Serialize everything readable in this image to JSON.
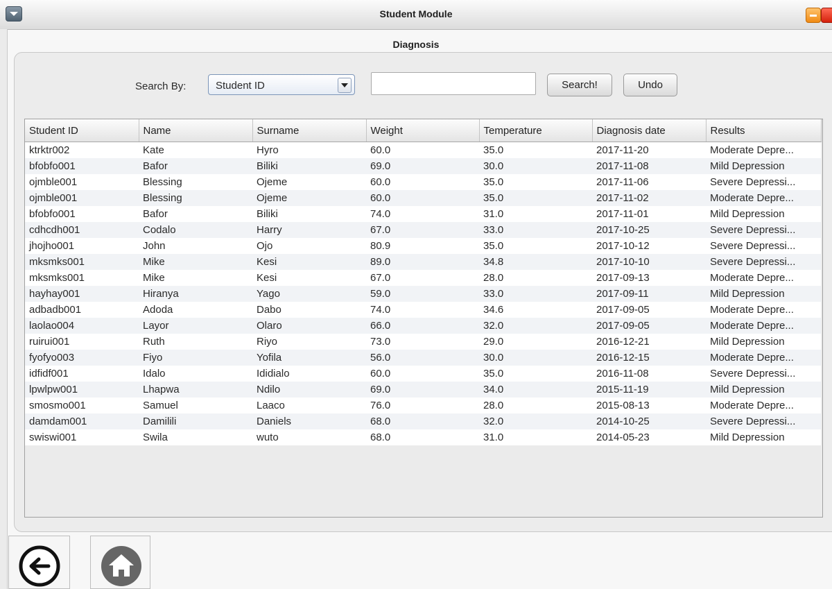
{
  "window": {
    "title": "Student Module"
  },
  "section": {
    "title": "Diagnosis"
  },
  "search": {
    "label": "Search By:",
    "combo_value": "Student ID",
    "field_value": "",
    "search_button": "Search!",
    "undo_button": "Undo"
  },
  "table": {
    "columns": [
      "Student ID",
      "Name",
      "Surname",
      "Weight",
      "Temperature",
      "Diagnosis date",
      "Results"
    ],
    "rows": [
      [
        "ktrktr002",
        "Kate",
        "Hyro",
        "60.0",
        "35.0",
        "2017-11-20",
        "Moderate Depre..."
      ],
      [
        "bfobfo001",
        "Bafor",
        "Biliki",
        "69.0",
        "30.0",
        "2017-11-08",
        "Mild Depression"
      ],
      [
        "ojmble001",
        "Blessing",
        "Ojeme",
        "60.0",
        "35.0",
        "2017-11-06",
        "Severe Depressi..."
      ],
      [
        "ojmble001",
        "Blessing",
        "Ojeme",
        "60.0",
        "35.0",
        "2017-11-02",
        "Moderate Depre..."
      ],
      [
        "bfobfo001",
        "Bafor",
        "Biliki",
        "74.0",
        "31.0",
        "2017-11-01",
        "Mild Depression"
      ],
      [
        "cdhcdh001",
        "Codalo",
        "Harry",
        "67.0",
        "33.0",
        "2017-10-25",
        "Severe Depressi..."
      ],
      [
        "jhojho001",
        "John",
        "Ojo",
        "80.9",
        "35.0",
        "2017-10-12",
        "Severe Depressi..."
      ],
      [
        "mksmks001",
        "Mike",
        "Kesi",
        "89.0",
        "34.8",
        "2017-10-10",
        "Severe Depressi..."
      ],
      [
        "mksmks001",
        "Mike",
        "Kesi",
        "67.0",
        "28.0",
        "2017-09-13",
        "Moderate Depre..."
      ],
      [
        "hayhay001",
        "Hiranya",
        "Yago",
        "59.0",
        "33.0",
        "2017-09-11",
        "Mild Depression"
      ],
      [
        "adbadb001",
        "Adoda",
        "Dabo",
        "74.0",
        "34.6",
        "2017-09-05",
        "Moderate Depre..."
      ],
      [
        "laolao004",
        "Layor",
        "Olaro",
        "66.0",
        "32.0",
        "2017-09-05",
        "Moderate Depre..."
      ],
      [
        "ruirui001",
        "Ruth",
        "Riyo",
        "73.0",
        "29.0",
        "2016-12-21",
        "Mild Depression"
      ],
      [
        "fyofyo003",
        "Fiyo",
        "Yofila",
        "56.0",
        "30.0",
        "2016-12-15",
        "Moderate Depre..."
      ],
      [
        "idfidf001",
        "Idalo",
        "Ididialo",
        "60.0",
        "35.0",
        "2016-11-08",
        "Severe Depressi..."
      ],
      [
        "lpwlpw001",
        "Lhapwa",
        "Ndilo",
        "69.0",
        "34.0",
        "2015-11-19",
        "Mild Depression"
      ],
      [
        "smosmo001",
        "Samuel",
        "Laaco",
        "76.0",
        "28.0",
        "2015-08-13",
        "Moderate Depre..."
      ],
      [
        "damdam001",
        "Damilili",
        "Daniels",
        "68.0",
        "32.0",
        "2014-10-25",
        "Severe Depressi..."
      ],
      [
        "swiswi001",
        "Swila",
        "wuto",
        "68.0",
        "31.0",
        "2014-05-23",
        "Mild Depression"
      ]
    ]
  },
  "nav": {
    "back_icon": "back-arrow-icon",
    "home_icon": "home-icon"
  },
  "colors": {
    "accent": "#7c95b8",
    "minimize": "#f08a14",
    "close": "#d4200c",
    "home": "#666666"
  }
}
